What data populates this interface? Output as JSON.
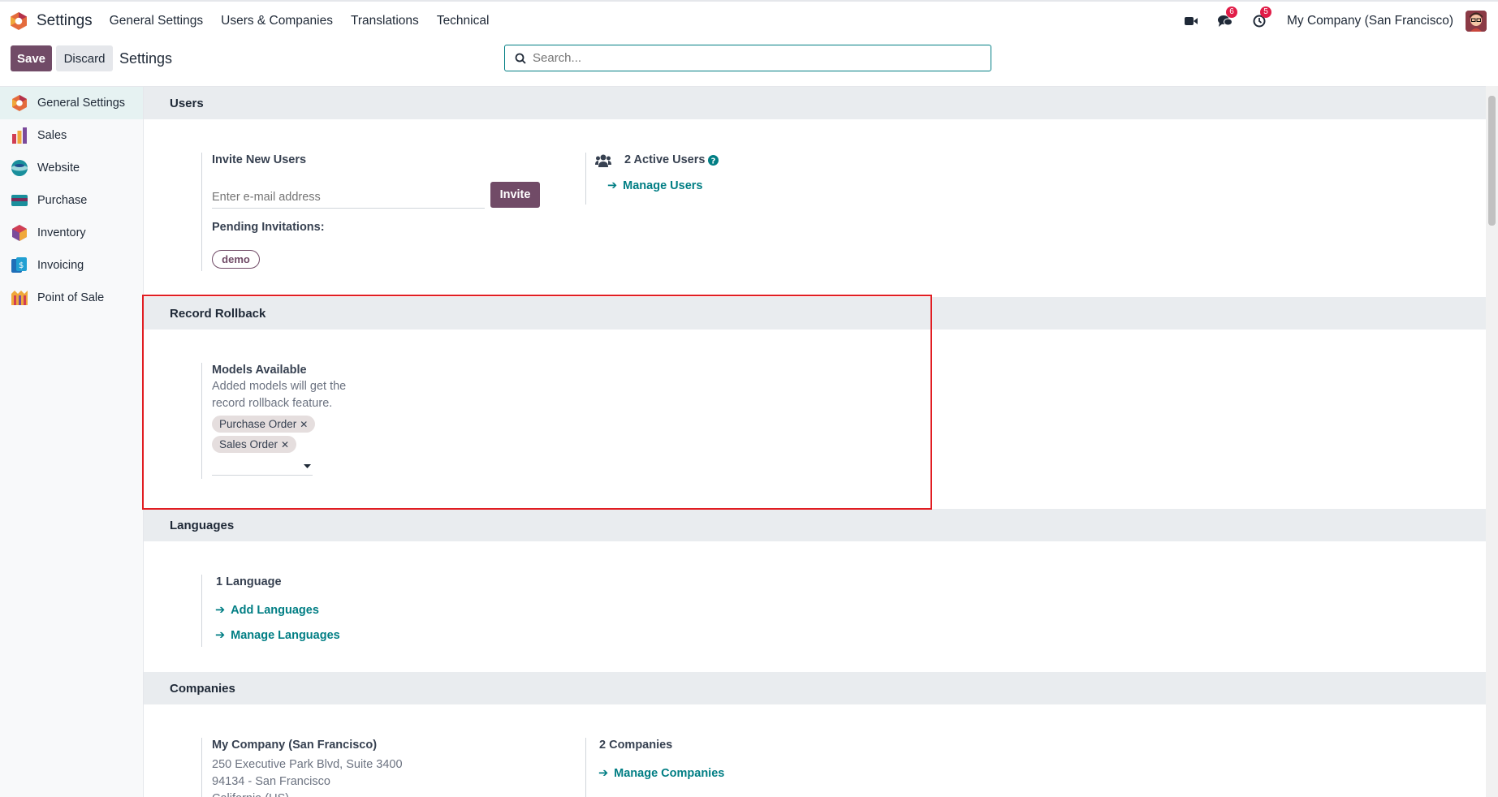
{
  "topbar": {
    "app_title": "Settings",
    "menu": [
      "General Settings",
      "Users & Companies",
      "Translations",
      "Technical"
    ],
    "messages_badge": "6",
    "activities_badge": "5",
    "company": "My Company (San Francisco)"
  },
  "control": {
    "save_label": "Save",
    "discard_label": "Discard",
    "breadcrumb": "Settings",
    "search_placeholder": "Search..."
  },
  "sidebar": {
    "items": [
      {
        "label": "General Settings",
        "icon": "odoo-logo-icon"
      },
      {
        "label": "Sales",
        "icon": "sales-icon"
      },
      {
        "label": "Website",
        "icon": "website-icon"
      },
      {
        "label": "Purchase",
        "icon": "purchase-icon"
      },
      {
        "label": "Inventory",
        "icon": "inventory-icon"
      },
      {
        "label": "Invoicing",
        "icon": "invoicing-icon"
      },
      {
        "label": "Point of Sale",
        "icon": "point-of-sale-icon"
      }
    ]
  },
  "users": {
    "title": "Users",
    "invite_label": "Invite New Users",
    "email_placeholder": "Enter e-mail address",
    "invite_button": "Invite",
    "pending_label": "Pending Invitations:",
    "pending_user": "demo",
    "active_users": "2 Active Users",
    "manage_users": "Manage Users"
  },
  "rollback": {
    "title": "Record Rollback",
    "models_label": "Models Available",
    "models_help": "Added models will get the record rollback feature.",
    "tags": [
      "Purchase Order",
      "Sales Order"
    ]
  },
  "languages": {
    "title": "Languages",
    "count": "1 Language",
    "add": "Add Languages",
    "manage": "Manage Languages"
  },
  "companies": {
    "title": "Companies",
    "company_name": "My Company (San Francisco)",
    "address_line1": "250 Executive Park Blvd, Suite 3400",
    "address_line2": "94134 - San Francisco",
    "address_line3": "California (US)",
    "count": "2 Companies",
    "manage": "Manage Companies"
  },
  "colors": {
    "primary": "#714B67",
    "link": "#017e84",
    "highlight": "#e11d22"
  }
}
